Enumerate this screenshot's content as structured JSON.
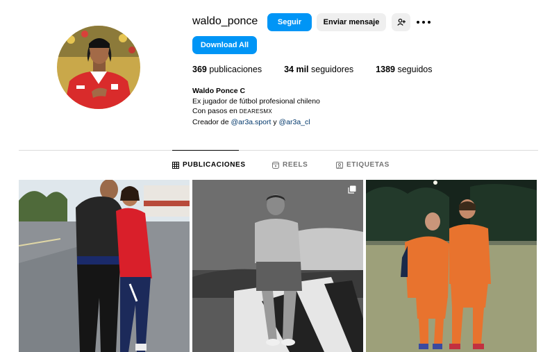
{
  "profile": {
    "username": "waldo_ponce",
    "follow_label": "Seguir",
    "message_label": "Enviar mensaje",
    "download_label": "Download All",
    "stats": {
      "posts_count": "369",
      "posts_label": "publicaciones",
      "followers_count": "34 mil",
      "followers_label": "seguidores",
      "following_count": "1389",
      "following_label": "seguidos"
    },
    "bio": {
      "full_name": "Waldo Ponce C",
      "line1": "Ex jugador de fútbol profesional chileno",
      "line2_prefix": "Con pasos en",
      "line2_brand": "DEARESMX",
      "line3_prefix": "Creador de",
      "mention1": "@ar3a.sport",
      "connector": "y",
      "mention2": "@ar3a_cl"
    }
  },
  "tabs": [
    {
      "label": "PUBLICACIONES",
      "icon": "grid-icon",
      "active": true
    },
    {
      "label": "REELS",
      "icon": "reels-icon",
      "active": false
    },
    {
      "label": "ETIQUETAS",
      "icon": "tagged-icon",
      "active": false
    }
  ],
  "posts": [
    {
      "type": "photo",
      "description_icon": "photo"
    },
    {
      "type": "carousel",
      "description_icon": "carousel-icon"
    },
    {
      "type": "photo",
      "description_icon": "photo"
    }
  ],
  "colors": {
    "primary_blue": "#0095f6",
    "button_gray": "#efefef",
    "mention": "#00376b",
    "muted": "#737373"
  }
}
